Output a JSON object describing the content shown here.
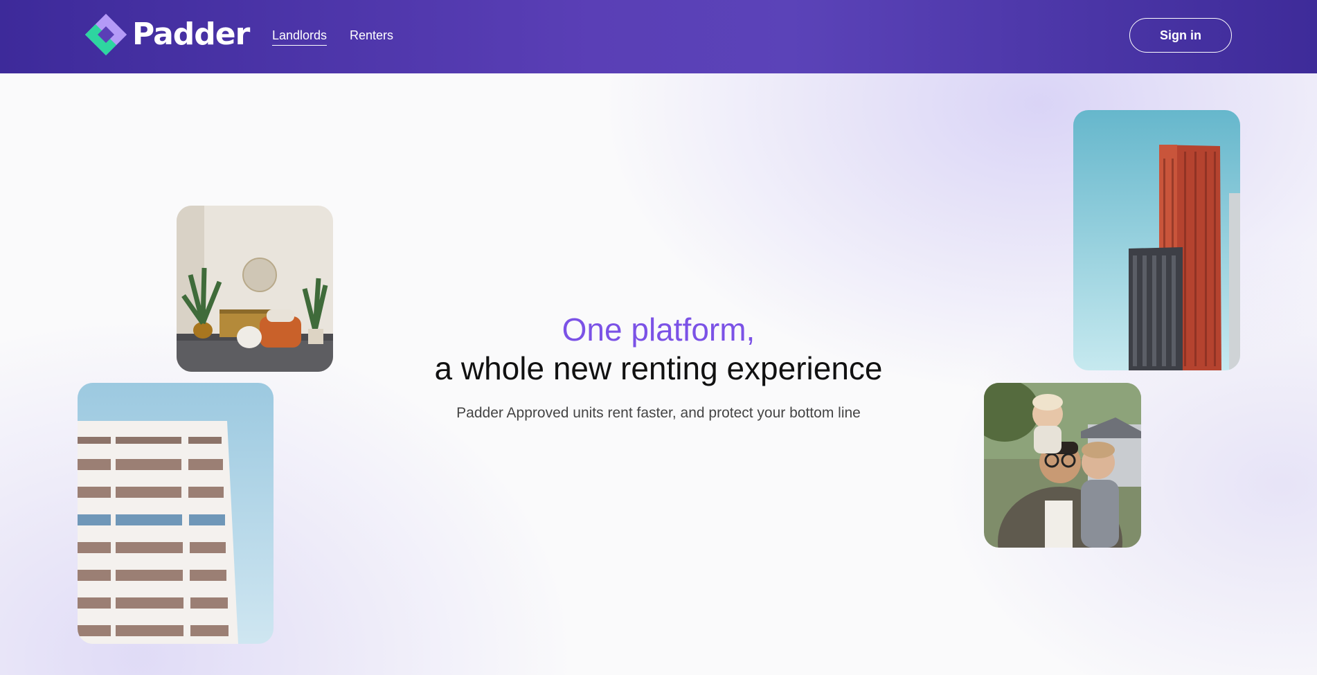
{
  "header": {
    "brand": "Padder",
    "logo_icon": "diamond-logo-icon",
    "nav": [
      {
        "label": "Landlords",
        "active": true
      },
      {
        "label": "Renters",
        "active": false
      }
    ],
    "signin_label": "Sign in"
  },
  "hero": {
    "title_line1": "One platform,",
    "title_line2": "a whole new renting experience",
    "subtitle": "Padder Approved units rent faster, and protect your bottom line"
  },
  "colors": {
    "nav_gradient_start": "#3d2a9a",
    "nav_gradient_mid": "#5a3fb6",
    "accent_purple": "#7b52e6",
    "logo_green": "#2ed5a0",
    "logo_violet": "#a98cf5"
  }
}
